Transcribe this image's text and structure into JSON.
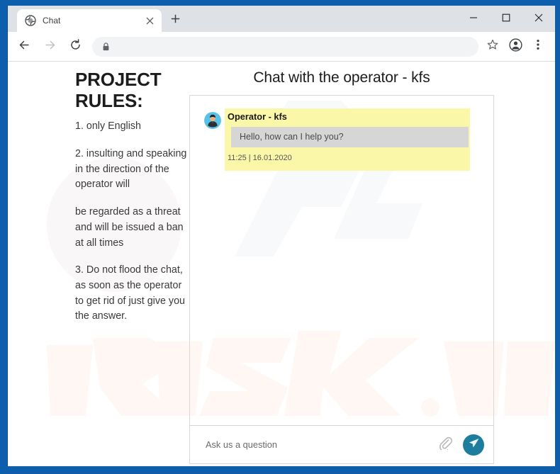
{
  "browser": {
    "tab": {
      "title": "Chat",
      "favicon_icon": "globe-icon",
      "close_icon": "close-icon"
    },
    "new_tab_icon": "plus-icon",
    "window_controls": {
      "minimize_icon": "minimize-icon",
      "maximize_icon": "maximize-icon",
      "close_icon": "close-icon"
    },
    "toolbar": {
      "back_icon": "back-arrow-icon",
      "forward_icon": "forward-arrow-icon",
      "reload_icon": "reload-icon",
      "lock_icon": "lock-icon",
      "address_value": "",
      "address_placeholder": "",
      "bookmark_icon": "star-icon",
      "profile_icon": "account-avatar-icon",
      "menu_icon": "three-dot-menu-icon"
    }
  },
  "page": {
    "rules": {
      "heading": "PROJECT RULES:",
      "items": [
        "1. only English",
        "2. insulting and speaking in the direction of the operator will",
        "be regarded as a threat and will be issued a ban at all times",
        "3. Do not flood the chat, as soon as the operator to get rid of just give you the answer."
      ]
    },
    "chat": {
      "title": "Chat with the operator - kfs",
      "messages": [
        {
          "sender": "Operator - kfs",
          "text": "Hello, how can I help you?",
          "time": "11:25 | 16.01.2020",
          "avatar_icon": "operator-avatar-icon",
          "highlighted": true
        }
      ],
      "composer": {
        "placeholder": "Ask us a question",
        "value": "",
        "attach_icon": "paperclip-icon",
        "send_icon": "send-paper-plane-icon"
      }
    },
    "watermark_text": "PCrisk.com"
  },
  "colors": {
    "window_frame": "#0d5fae",
    "tabstrip": "#dee1e6",
    "omnibox": "#f1f3f4",
    "highlight_yellow": "#fbf7a8",
    "bubble_gray": "#d6d6d6",
    "send_button": "#1c7e9c"
  }
}
